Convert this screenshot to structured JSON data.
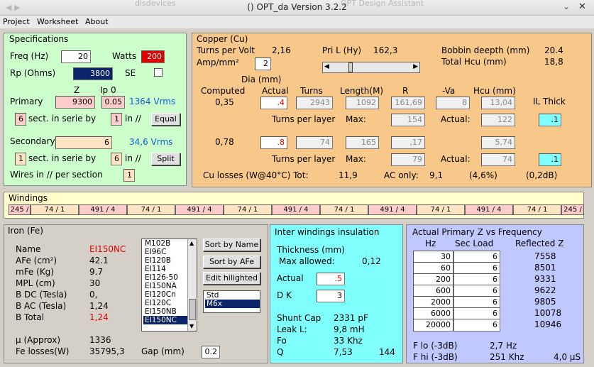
{
  "window": {
    "title": "()  OPT_da Version 3.2.2",
    "bg_left": "disdevices",
    "bg_right": "OPT Design Assistant"
  },
  "menu": [
    "Project",
    "Worksheet",
    "About"
  ],
  "specs": {
    "title": "Specifications",
    "freq_label": "Freq (Hz)",
    "freq": "20",
    "watts_label": "Watts",
    "watts": "200",
    "rp_label": "Rp (Ohms)",
    "rp": "3800",
    "se_label": "SE",
    "z_label": "Z",
    "ip0_label": "Ip 0",
    "primary_label": "Primary",
    "primary_z": "9300",
    "primary_ip0": "0.05",
    "primary_vrms": "1364 Vrms",
    "prim_sect": "6",
    "sect_label": "sect. in serie by",
    "prim_par": "1",
    "in_label": "in //",
    "equal_btn": "Equal",
    "secondary_label": "Secondary",
    "sec_z": "6",
    "sec_vrms": "34,6 Vrms",
    "sec_sect": "1",
    "sec_par": "6",
    "split_btn": "Split",
    "wires_label": "Wires in // per section",
    "wires": "1"
  },
  "copper": {
    "title": "Copper (Cu)",
    "tpv_label": "Turns per Volt",
    "tpv": "2,16",
    "amp_label": "Amp/mm²",
    "amp": "2",
    "pril_label": "Pri L (Hy)",
    "pril": "162,3",
    "slider_value": 0.2,
    "bobbin_label": "Bobbin deepth (mm)",
    "bobbin": "20.4",
    "hcu_total_label": "Total Hcu (mm)",
    "hcu_total": "18,8",
    "dia_label": "Dia (mm)",
    "h_computed": "Computed",
    "h_actual": "Actual",
    "h_turns": "Turns",
    "h_length": "Length(M)",
    "h_r": "R",
    "h_va": "-Va",
    "h_hcu": "Hcu (mm)",
    "h_il": "IL Thick",
    "p_comp": "0,35",
    "p_act": ".4",
    "p_turns": "2943",
    "p_len": "1092",
    "p_r": "161,69",
    "p_va": "8",
    "p_hcu": "13,04",
    "tpl_label": "Turns per layer",
    "max_label": "Max:",
    "actual_label": "Actual:",
    "p_max": "154",
    "p_actual": "122",
    "p_il": ".1",
    "s_comp": "0,78",
    "s_act": ".8",
    "s_turns": "74",
    "s_len": "165",
    "s_r": ",17",
    "s_hcu": "5,74",
    "s_max": "79",
    "s_actual": "74",
    "s_il": ".1",
    "losses_label": "Cu losses  (W@40°C) Tot:",
    "losses_tot": "11,9",
    "ac_label": "AC only:",
    "ac": "9,1",
    "pct": "(4,6%)",
    "db": "(0,2dB)"
  },
  "windings": {
    "title": "Windings",
    "items": [
      "245 /",
      "74 / 1",
      "491 / 4",
      "74 / 1",
      "491 / 4",
      "74 / 1",
      "491 / 4",
      "74 / 1",
      "491 / 4",
      "74 / 1",
      "491 / 4",
      "74 / 1",
      "245 /"
    ]
  },
  "iron": {
    "title": "Iron (Fe)",
    "name_label": "Name",
    "name": "EI150NC",
    "afe_label": "AFe (cm²)",
    "afe": "42.1",
    "mfe_label": "mFe (Kg)",
    "mfe": "9.7",
    "mpl_label": "MPL (cm)",
    "mpl": "30",
    "bdc_label": "B DC (Tesla)",
    "bdc": "0,",
    "bac_label": "B AC (Tesla)",
    "bac": "1,24",
    "btot_label": "B Total",
    "btot": "1,24",
    "mu_label": "µ (Approx)",
    "mu": "1336",
    "fel_label": "Fe losses(W)",
    "fel": "35795,3",
    "gap_label": "Gap (mm)",
    "gap": "0.2",
    "cores": [
      "M102B",
      "EI96C",
      "EI120B",
      "EI114",
      "EI126-50",
      "EI150NA",
      "EI120Cn",
      "EI120C",
      "EI150NB",
      "EI150NC"
    ],
    "selected_core": "EI150NC",
    "sort_name": "Sort by Name",
    "sort_afe": "Sort by AFe",
    "edit_btn": "Edit hilighted",
    "mats": [
      "Std",
      "M6x"
    ],
    "selected_mat": "M6x"
  },
  "inter": {
    "title": "Inter windings insulation",
    "thick_label": "Thickness (mm)",
    "max_label": "Max allowed:",
    "max": "0,12",
    "actual_label": "Actual",
    "actual": ".5",
    "dk_label": "D K",
    "dk": "3",
    "shunt_label": "Shunt Cap",
    "shunt": "2331 pF",
    "leak_label": "Leak L:",
    "leak": "9,8 mH",
    "fo_label": "Fo",
    "fo": "33 Khz",
    "q_label": "Q",
    "q": "7,53",
    "q2": "144"
  },
  "zfreq": {
    "title": "Actual Primary Z vs Frequency",
    "h_hz": "Hz",
    "h_load": "Sec Load",
    "h_refl": "Reflected Z",
    "rows": [
      {
        "hz": "30",
        "load": "6",
        "z": "7558"
      },
      {
        "hz": "60",
        "load": "6",
        "z": "8501"
      },
      {
        "hz": "200",
        "load": "6",
        "z": "9331"
      },
      {
        "hz": "600",
        "load": "6",
        "z": "9622"
      },
      {
        "hz": "2000",
        "load": "6",
        "z": "9805"
      },
      {
        "hz": "6000",
        "load": "6",
        "z": "10078"
      },
      {
        "hz": "20000",
        "load": "6",
        "z": "10946"
      }
    ],
    "flo_label": "F lo (-3dB)",
    "flo": "2,7 Hz",
    "fhi_label": "F hi (-3dB)",
    "fhi": "251 Khz",
    "rise": "4,0 µS"
  }
}
